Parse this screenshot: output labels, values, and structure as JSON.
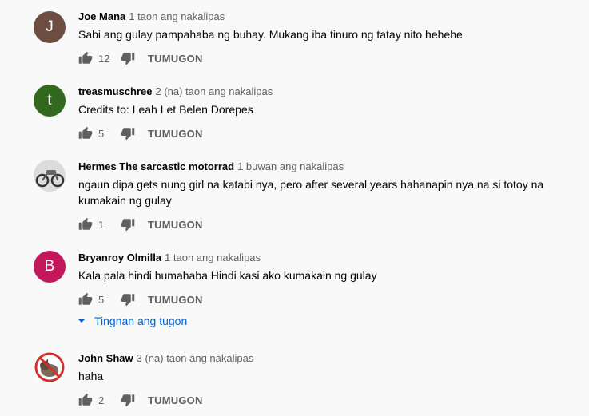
{
  "comments": [
    {
      "author": "Joe Mana",
      "time": "1 taon ang nakalipas",
      "text": "Sabi ang gulay pampahaba ng buhay. Mukang iba tinuro ng tatay nito hehehe",
      "likes": "12",
      "reply_label": "TUMUGON",
      "avatar_letter": "J",
      "avatar_color": "#6d4c41"
    },
    {
      "author": "treasmuschree",
      "time": "2 (na) taon ang nakalipas",
      "text": "Credits to: Leah Let Belen Dorepes",
      "likes": "5",
      "reply_label": "TUMUGON",
      "avatar_letter": "t",
      "avatar_color": "#33691e"
    },
    {
      "author": "Hermes The sarcastic motorrad",
      "time": "1 buwan ang nakalipas",
      "text": "ngaun dipa gets nung girl na katabi nya, pero after several years hahanapin nya na si totoy na kumakain ng gulay",
      "likes": "1",
      "reply_label": "TUMUGON",
      "avatar_icon": "motorcycle-avatar"
    },
    {
      "author": "Bryanroy Olmilla",
      "time": "1 taon ang nakalipas",
      "text": "Kala pala hindi humahaba Hindi kasi ako kumakain ng gulay",
      "likes": "5",
      "reply_label": "TUMUGON",
      "avatar_letter": "B",
      "avatar_color": "#c2185b",
      "view_replies_label": "Tingnan ang tugon"
    },
    {
      "author": "John Shaw",
      "time": "3 (na) taon ang nakalipas",
      "text": "haha",
      "likes": "2",
      "reply_label": "TUMUGON",
      "avatar_icon": "no-cat-avatar"
    }
  ],
  "colors": {
    "link": "#065fd4",
    "meta": "#606060"
  }
}
